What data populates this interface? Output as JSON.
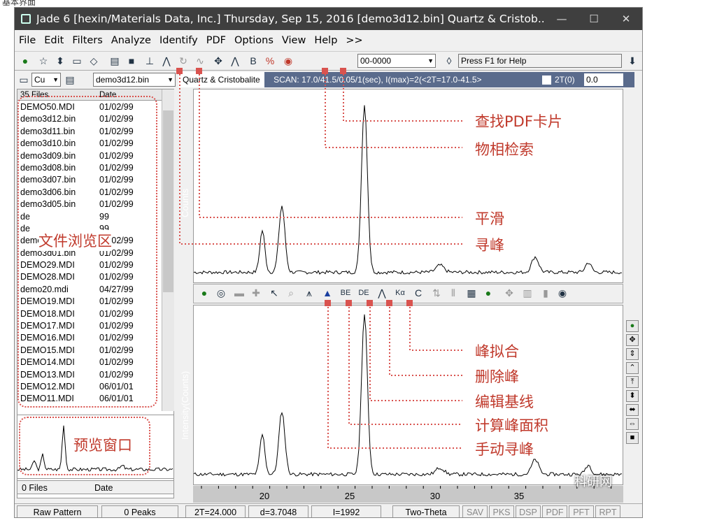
{
  "top_caption": "基本界面",
  "window": {
    "title": "Jade 6 [hexin/Materials Data, Inc.] Thursday, Sep 15, 2016 [demo3d12.bin] Quartz & Cristob...",
    "minimize": "—",
    "maximize": "☐",
    "close": "✕"
  },
  "menu": [
    "File",
    "Edit",
    "Filters",
    "Analyze",
    "Identify",
    "PDF",
    "Options",
    "View",
    "Help",
    ">>"
  ],
  "toolbar": {
    "pdf_combo": "00-0000",
    "help_text": "Press F1 for Help",
    "pin": "⬇"
  },
  "toolbar2": {
    "element": "Cu",
    "file_combo": "demo3d12.bin",
    "phase": "Quartz & Cristobalite",
    "scan": "SCAN: 17.0/41.5/0.05/1(sec), I(max)=2(<2T=17.0-41.5>",
    "twotheta_label": "2T(0)",
    "twotheta_value": "0.0"
  },
  "file_browser": {
    "header_count": "35 Files",
    "header_date": "Date",
    "files": [
      [
        "DEMO50.MDI",
        "01/02/99"
      ],
      [
        "demo3d12.bin",
        "01/02/99"
      ],
      [
        "demo3d11.bin",
        "01/02/99"
      ],
      [
        "demo3d10.bin",
        "01/02/99"
      ],
      [
        "demo3d09.bin",
        "01/02/99"
      ],
      [
        "demo3d08.bin",
        "01/02/99"
      ],
      [
        "demo3d07.bin",
        "01/02/99"
      ],
      [
        "demo3d06.bin",
        "01/02/99"
      ],
      [
        "demo3d05.bin",
        "01/02/99"
      ],
      [
        "de",
        "99"
      ],
      [
        "de",
        "99"
      ],
      [
        "demo3d02.bin",
        "01/02/99"
      ],
      [
        "demo3d01.bin",
        "01/02/99"
      ],
      [
        "DEMO29.MDI",
        "01/02/99"
      ],
      [
        "DEMO28.MDI",
        "01/02/99"
      ],
      [
        "demo20.mdi",
        "04/27/99"
      ],
      [
        "DEMO19.MDI",
        "01/02/99"
      ],
      [
        "DEMO18.MDI",
        "01/02/99"
      ],
      [
        "DEMO17.MDI",
        "01/02/99"
      ],
      [
        "DEMO16.MDI",
        "01/02/99"
      ],
      [
        "DEMO15.MDI",
        "01/02/99"
      ],
      [
        "DEMO14.MDI",
        "01/02/99"
      ],
      [
        "DEMO13.MDI",
        "01/02/99"
      ],
      [
        "DEMO12.MDI",
        "06/01/01"
      ],
      [
        "DEMO11.MDI",
        "06/01/01"
      ]
    ],
    "bottom_count": "0 Files",
    "bottom_date": "Date"
  },
  "plot1": {
    "ylabel": "Counts"
  },
  "plot2": {
    "ylabel": "Intensity(Counts)"
  },
  "xaxis": {
    "ticks": [
      "20",
      "25",
      "30",
      "35"
    ]
  },
  "status": {
    "mode": "Raw Pattern",
    "peaks": "0 Peaks",
    "twotheta": "2T=24.000",
    "d": "d=3.7048",
    "i": "I=1992",
    "axis": "Two-Theta",
    "tabs": [
      "SAV",
      "PKS",
      "DSP",
      "PDF",
      "PFT",
      "RPT"
    ]
  },
  "annotations": {
    "find_pdf": "查找PDF卡片",
    "phase_search": "物相检索",
    "smooth": "平滑",
    "peak_search": "寻峰",
    "file_browser": "文件浏览区",
    "preview": "预览窗口",
    "peak_fit": "峰拟合",
    "delete_peak": "删除峰",
    "edit_baseline": "编辑基线",
    "peak_area": "计算峰面积",
    "manual_peak": "手动寻峰"
  },
  "watermark": "科研网",
  "colors": {
    "annotation": "#c0392b",
    "titlebar": "#3f3f3f",
    "scanbar": "#5a6b8c"
  }
}
